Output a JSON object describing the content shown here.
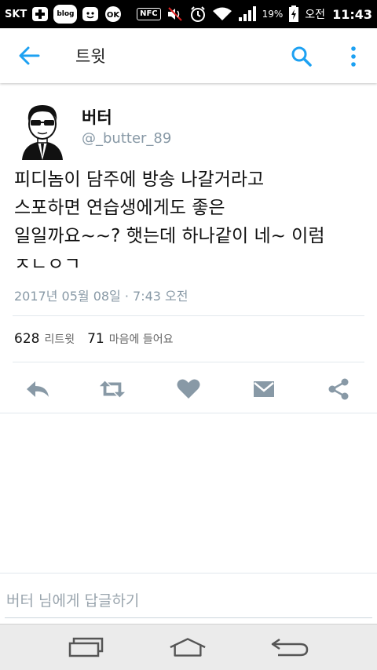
{
  "status_bar": {
    "carrier": "SKT",
    "blog_badge": "blog",
    "ok_badge": "OK",
    "nfc": "NFC",
    "battery_percent": "19%",
    "ampm": "오전",
    "time": "11:43"
  },
  "app_bar": {
    "title": "트윗"
  },
  "tweet": {
    "name": "버터",
    "handle": "@_butter_89",
    "body_lines": [
      "피디놈이 담주에 방송 나갈거라고",
      "스포하면 연습생에게도 좋은",
      "일일까요~~? 햇는데 하나같이 네~ 이럼",
      "ㅈㄴㅇㄱ"
    ],
    "timestamp": "2017년 05월 08일 · 7:43 오전",
    "retweet_count": "628",
    "retweet_label": "리트윗",
    "like_count": "71",
    "like_label": "마음에 들어요"
  },
  "reply": {
    "placeholder": "버터 님에게 답글하기"
  },
  "colors": {
    "accent": "#1da1f2",
    "action_gray": "#8899a6",
    "text": "#111111"
  },
  "icons": {
    "back": "arrow-left-icon",
    "search": "search-icon",
    "more": "more-vertical-icon",
    "reply": "reply-icon",
    "retweet": "retweet-icon",
    "like": "heart-icon",
    "dm": "envelope-icon",
    "share": "share-icon",
    "recents": "recent-apps-icon",
    "home": "home-icon",
    "nav_back": "nav-back-icon"
  }
}
